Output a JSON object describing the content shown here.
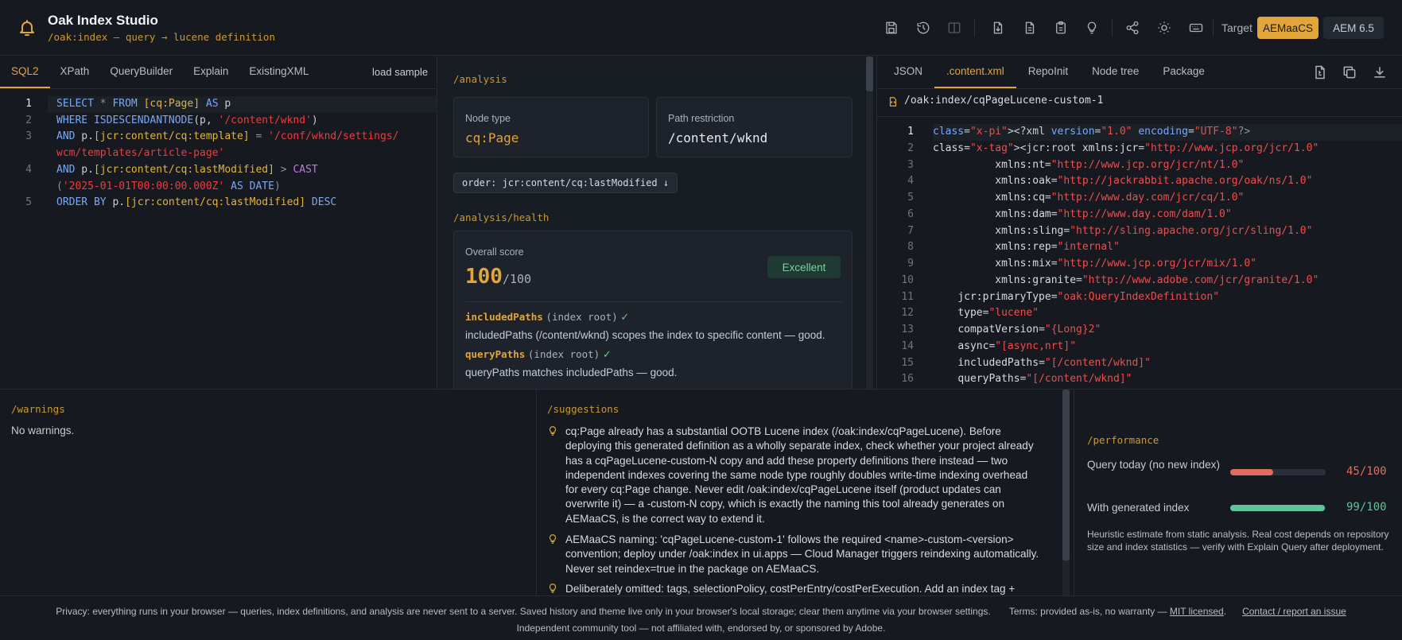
{
  "header": {
    "title": "Oak Index Studio",
    "subtitle": "/oak:index — query → lucene definition",
    "toolbar_icons": [
      "save-icon",
      "history-icon",
      "split-view-icon",
      "import-icon",
      "document-icon",
      "clipboard-icon",
      "lightbulb-icon",
      "share-icon",
      "theme-icon",
      "keyboard-icon"
    ],
    "target_label": "Target",
    "targets": [
      "AEMaaCS",
      "AEM 6.5"
    ],
    "active_target": "AEMaaCS",
    "accent": "#e2a53a"
  },
  "query_panel": {
    "tabs": [
      "SQL2",
      "XPath",
      "QueryBuilder",
      "Explain",
      "ExistingXML"
    ],
    "active_tab": "SQL2",
    "load_sample": "load sample",
    "line_numbers": [
      "1",
      "2",
      "3",
      "",
      "4",
      "",
      "5"
    ],
    "code": [
      "SELECT * FROM [cq:Page] AS p",
      "WHERE ISDESCENDANTNODE(p, '/content/wknd')",
      "AND p.[jcr:content/cq:template] = '/conf/wknd/settings/",
      "wcm/templates/article-page'",
      "AND p.[jcr:content/cq:lastModified] > CAST",
      "('2025-01-01T00:00:00.000Z' AS DATE)",
      "ORDER BY p.[jcr:content/cq:lastModified] DESC"
    ]
  },
  "analysis": {
    "heading": "/analysis",
    "node_type_label": "Node type",
    "node_type": "cq:Page",
    "path_restriction_label": "Path restriction",
    "path_restriction": "/content/wknd",
    "order_pill": "order: jcr:content/cq:lastModified ↓",
    "health_heading": "/analysis/health",
    "overall_label": "Overall score",
    "score": "100",
    "score_max": "/100",
    "badge": "Excellent",
    "items": [
      {
        "key": "includedPaths",
        "scope": "(index root)",
        "check": "✓",
        "desc": "includedPaths (/content/wknd) scopes the index to specific content — good."
      },
      {
        "key": "queryPaths",
        "scope": "(index root)",
        "check": "✓",
        "desc": "queryPaths matches includedPaths — good."
      }
    ]
  },
  "output_panel": {
    "tabs": [
      "JSON",
      ".content.xml",
      "RepoInit",
      "Node tree",
      "Package"
    ],
    "active_tab": ".content.xml",
    "action_icons": [
      "export-icon",
      "copy-icon",
      "download-icon"
    ],
    "file_path": "/oak:index/cqPageLucene-custom-1",
    "xml_lines": [
      "<?xml version=\"1.0\" encoding=\"UTF-8\"?>",
      "<jcr:root xmlns:jcr=\"http://www.jcp.org/jcr/1.0\"",
      "          xmlns:nt=\"http://www.jcp.org/jcr/nt/1.0\"",
      "          xmlns:oak=\"http://jackrabbit.apache.org/oak/ns/1.0\"",
      "          xmlns:cq=\"http://www.day.com/jcr/cq/1.0\"",
      "          xmlns:dam=\"http://www.day.com/dam/1.0\"",
      "          xmlns:sling=\"http://sling.apache.org/jcr/sling/1.0\"",
      "          xmlns:rep=\"internal\"",
      "          xmlns:mix=\"http://www.jcp.org/jcr/mix/1.0\"",
      "          xmlns:granite=\"http://www.adobe.com/jcr/granite/1.0\"",
      "    jcr:primaryType=\"oak:QueryIndexDefinition\"",
      "    type=\"lucene\"",
      "    compatVersion=\"{Long}2\"",
      "    async=\"[async,nrt]\"",
      "    includedPaths=\"[/content/wknd]\"",
      "    queryPaths=\"[/content/wknd]\""
    ]
  },
  "warnings": {
    "heading": "/warnings",
    "text": "No warnings."
  },
  "suggestions": {
    "heading": "/suggestions",
    "items": [
      "cq:Page already has a substantial OOTB Lucene index (/oak:index/cqPageLucene). Before deploying this generated definition as a wholly separate index, check whether your project already has a cqPageLucene-custom-N copy and add these property definitions there instead — two independent indexes covering the same node type roughly doubles write-time indexing overhead for every cq:Page change. Never edit /oak:index/cqPageLucene itself (product updates can overwrite it) — a -custom-N copy, which is exactly the naming this tool already generates on AEMaaCS, is the correct way to extend it.",
      "AEMaaCS naming: 'cqPageLucene-custom-1' follows the required <name>-custom-<version> convention; deploy under /oak:index in ui.apps — Cloud Manager triggers reindexing automatically. Never set reindex=true in the package on AEMaaCS.",
      "Deliberately omitted: tags, selectionPolicy, costPerEntry/costPerExecution. Add an index tag +"
    ]
  },
  "performance": {
    "heading": "/performance",
    "rows": [
      {
        "label": "Query today (no new index)",
        "value": 45,
        "display": "45/100",
        "color": "#e06c5e"
      },
      {
        "label": "With generated index",
        "value": 99,
        "display": "99/100",
        "color": "#5fc49a"
      }
    ],
    "note": "Heuristic estimate from static analysis. Real cost depends on repository size and index statistics — verify with Explain Query after deployment."
  },
  "footer": {
    "privacy": "Privacy: everything runs in your browser — queries, index definitions, and analysis are never sent to a server. Saved history and theme live only in your browser's local storage; clear them anytime via your browser settings.",
    "terms_prefix": "Terms: provided as-is, no warranty —",
    "license_link": "MIT licensed",
    "dot": ".",
    "contact_link": "Contact / report an issue",
    "disclaimer": "Independent community tool — not affiliated with, endorsed by, or sponsored by Adobe."
  }
}
